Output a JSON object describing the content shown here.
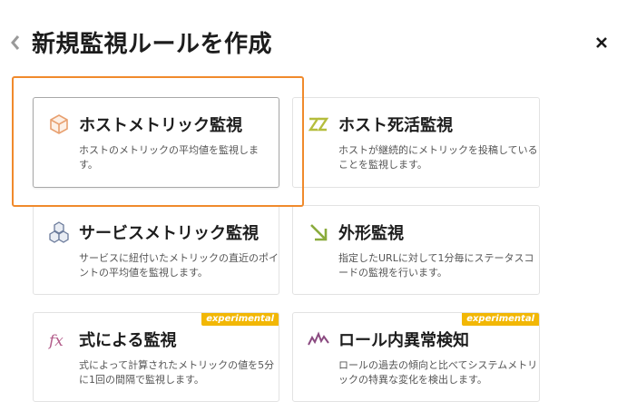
{
  "header": {
    "title": "新規監視ルールを作成",
    "back_icon": "chevron-left-icon",
    "close_icon": "close-icon"
  },
  "colors": {
    "highlight": "#f08a2c",
    "badge": "#f2b705",
    "icon_host": "#e8a070",
    "icon_connectivity": "#b5bd3c",
    "icon_service": "#6a7a9a",
    "icon_external": "#8aab3c",
    "icon_expression": "#b35c8a",
    "icon_anomaly": "#8a4a80"
  },
  "cards": [
    {
      "title": "ホストメトリック監視",
      "desc": "ホストのメトリックの平均値を監視します。",
      "icon": "cube-icon",
      "selected": true
    },
    {
      "title": "ホスト死活監視",
      "desc": "ホストが継続的にメトリックを投稿していることを監視します。",
      "icon": "zz-icon"
    },
    {
      "title": "サービスメトリック監視",
      "desc": "サービスに紐付いたメトリックの直近のポイントの平均値を監視します。",
      "icon": "cubes-icon"
    },
    {
      "title": "外形監視",
      "desc": "指定したURLに対して1分毎にステータスコードの監視を行います。",
      "icon": "arrow-icon"
    },
    {
      "title": "式による監視",
      "desc": "式によって計算されたメトリックの値を5分に1回の間隔で監視します。",
      "icon": "fx-icon",
      "badge": "experimental"
    },
    {
      "title": "ロール内異常検知",
      "desc": "ロールの過去の傾向と比べてシステムメトリックの特異な変化を検出します。",
      "icon": "wave-icon",
      "badge": "experimental"
    }
  ]
}
